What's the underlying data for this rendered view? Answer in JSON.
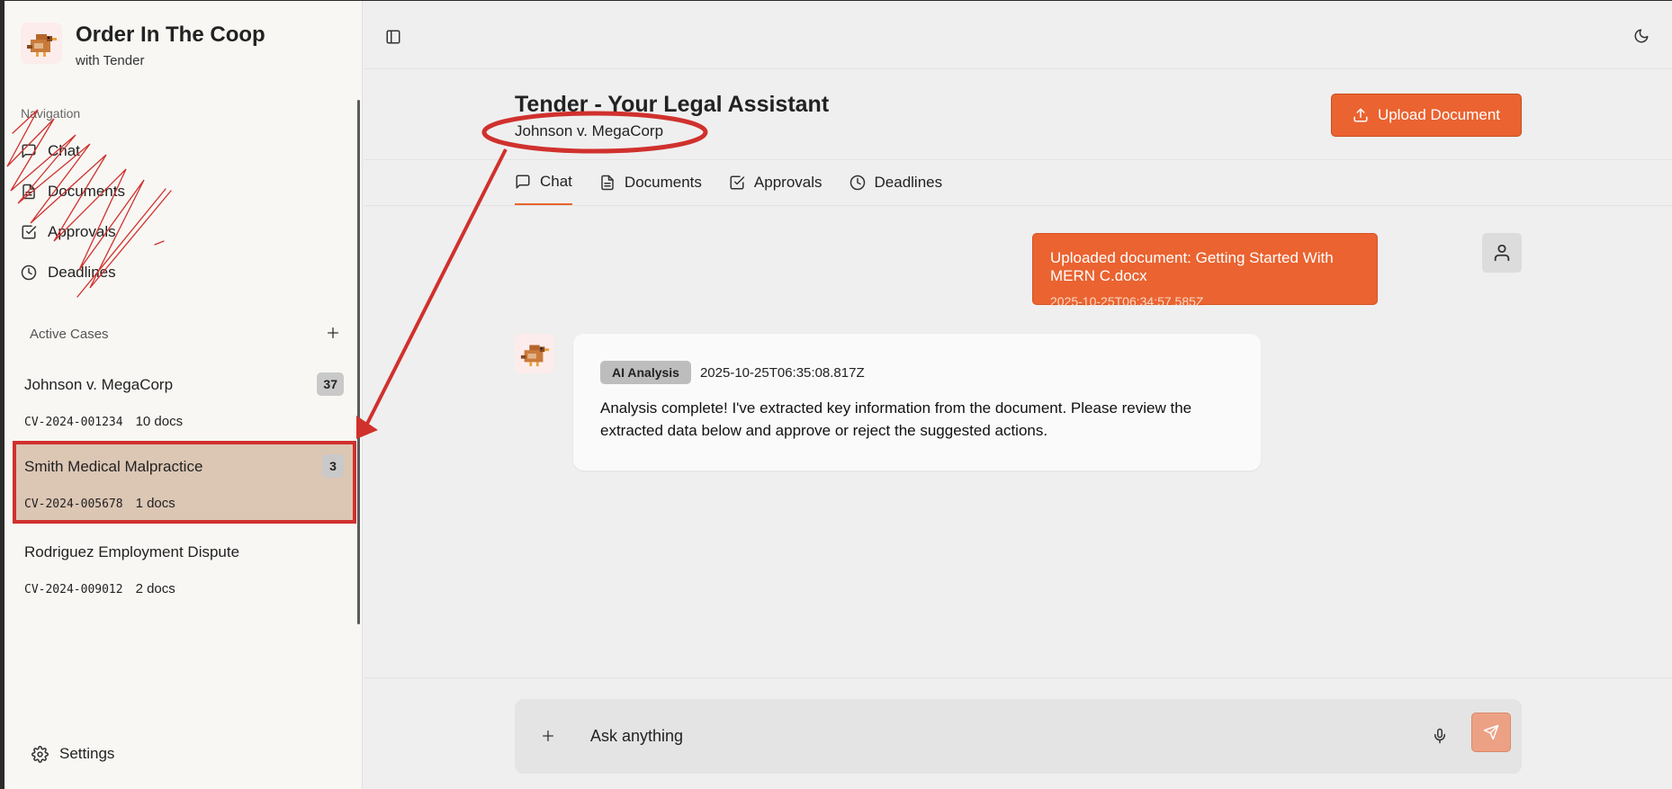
{
  "brand": {
    "title": "Order In The Coop",
    "subtitle": "with Tender"
  },
  "nav": {
    "heading": "Navigation",
    "items": [
      {
        "label": "Chat",
        "icon": "message-square-icon"
      },
      {
        "label": "Documents",
        "icon": "file-text-icon"
      },
      {
        "label": "Approvals",
        "icon": "check-square-icon"
      },
      {
        "label": "Deadlines",
        "icon": "clock-icon"
      }
    ]
  },
  "cases": {
    "heading": "Active Cases",
    "add_icon": "plus-icon",
    "items": [
      {
        "name": "Johnson v. MegaCorp",
        "badge": "37",
        "number": "CV-2024-001234",
        "docs": "10 docs"
      },
      {
        "name": "Smith Medical Malpractice",
        "badge": "3",
        "number": "CV-2024-005678",
        "docs": "1 docs"
      },
      {
        "name": "Rodriguez Employment Dispute",
        "badge": "",
        "number": "CV-2024-009012",
        "docs": "2 docs"
      }
    ]
  },
  "settings": {
    "label": "Settings"
  },
  "header": {
    "title": "Tender - Your Legal Assistant",
    "case_name": "Johnson v. MegaCorp",
    "upload_label": "Upload Document"
  },
  "tabs": [
    {
      "label": "Chat",
      "icon": "message-square-icon",
      "active": true
    },
    {
      "label": "Documents",
      "icon": "file-text-icon",
      "active": false
    },
    {
      "label": "Approvals",
      "icon": "check-square-icon",
      "active": false
    },
    {
      "label": "Deadlines",
      "icon": "clock-icon",
      "active": false
    }
  ],
  "messages": {
    "user": {
      "text": "Uploaded document: Getting Started With MERN C.docx",
      "timestamp": "2025-10-25T06:34:57.585Z"
    },
    "assistant": {
      "badge": "AI Analysis",
      "timestamp": "2025-10-25T06:35:08.817Z",
      "text": "Analysis complete! I've extracted key information from the document. Please review the extracted data below and approve or reject the suggested actions."
    }
  },
  "composer": {
    "placeholder": "Ask anything"
  },
  "colors": {
    "accent": "#ea6330",
    "sidebar_bg": "#f8f7f4",
    "main_bg": "#efefef",
    "selected_case_bg": "#dcc6b4",
    "annotation_red": "#d0312d"
  }
}
